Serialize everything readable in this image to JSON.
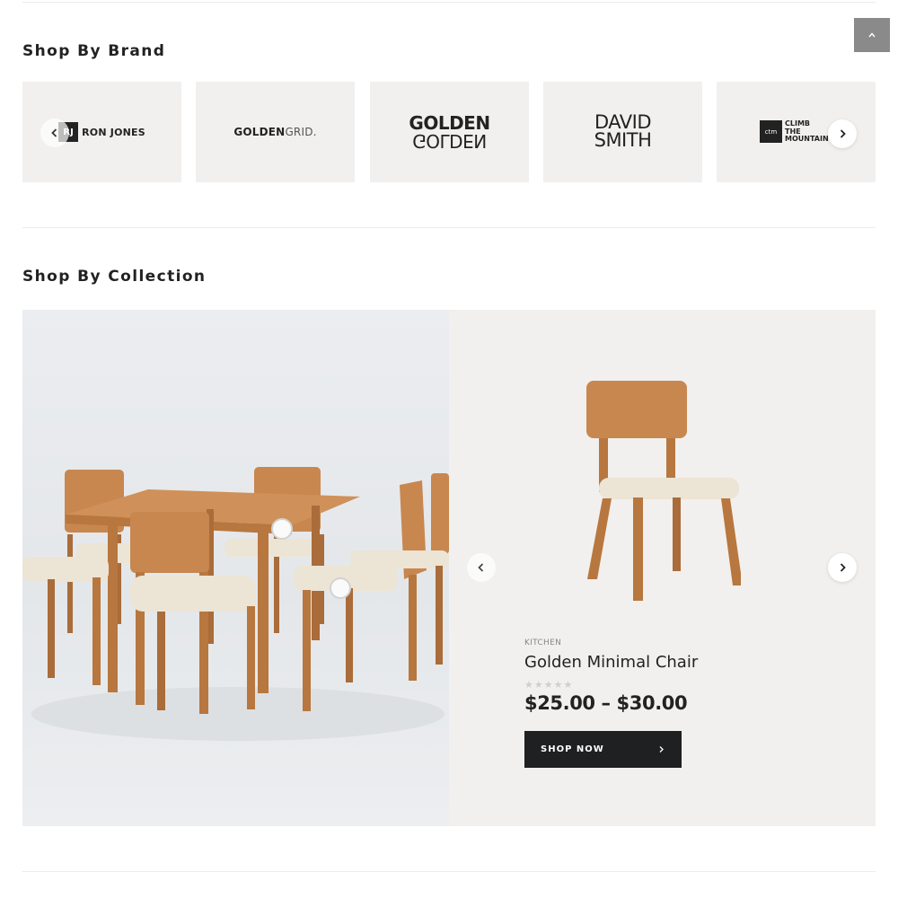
{
  "sections": {
    "brand_title": "Shop By Brand",
    "collection_title": "Shop By Collection"
  },
  "brands": [
    {
      "mark": "RJ",
      "name": "RON JONES"
    },
    {
      "bold": "GOLDEN",
      "light": "GRID."
    },
    {
      "top": "GOLDEN",
      "bottom": "GOLDEN"
    },
    {
      "line1": "DAVID",
      "line2": "SMITH"
    },
    {
      "mark": "ctm",
      "line1": "CLIMB",
      "line2": "THE",
      "line3": "MOUNTAIN"
    }
  ],
  "product": {
    "category": "KITCHEN",
    "title": "Golden Minimal Chair",
    "rating_stars": "★★★★★",
    "rating": 0,
    "price": "$25.00 – $30.00",
    "cta": "SHOP NOW"
  },
  "colors": {
    "wood": "#c8874f",
    "wood_dark": "#a96c3a",
    "cushion": "#ece4d5",
    "button_bg": "#1f2022",
    "card_bg": "#f1f0ee"
  },
  "icons": {
    "back_to_top": "chevron-up-icon",
    "prev": "chevron-left-icon",
    "next": "chevron-right-icon",
    "cta_arrow": "chevron-right-icon"
  }
}
